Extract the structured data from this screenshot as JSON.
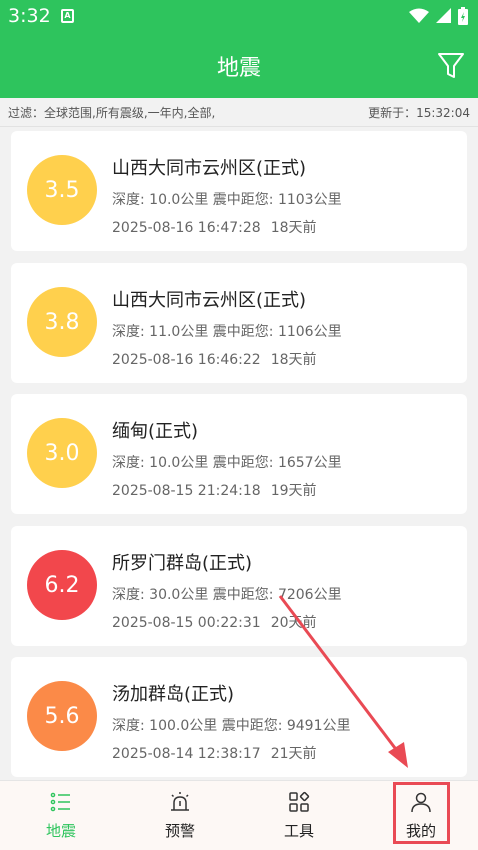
{
  "status": {
    "time": "3:32",
    "app_icon": "A"
  },
  "appbar": {
    "title": "地震"
  },
  "filter": {
    "text": "过滤：全球范围,所有震级,一年内,全部,",
    "updated": "更新于：15:32:04"
  },
  "quakes": [
    {
      "mag": "3.5",
      "place": "山西大同市云州区(正式)",
      "detail": "深度: 10.0公里   震中距您: 1103公里",
      "time": "2025-08-16 16:47:28",
      "ago": "18天前",
      "color": "#ffd04d"
    },
    {
      "mag": "3.8",
      "place": "山西大同市云州区(正式)",
      "detail": "深度: 11.0公里   震中距您: 1106公里",
      "time": "2025-08-16 16:46:22",
      "ago": "18天前",
      "color": "#ffd04d"
    },
    {
      "mag": "3.0",
      "place": "缅甸(正式)",
      "detail": "深度: 10.0公里   震中距您: 1657公里",
      "time": "2025-08-15 21:24:18",
      "ago": "19天前",
      "color": "#ffd04d"
    },
    {
      "mag": "6.2",
      "place": "所罗门群岛(正式)",
      "detail": "深度: 30.0公里   震中距您: 7206公里",
      "time": "2025-08-15 00:22:31",
      "ago": "20天前",
      "color": "#f2474c"
    },
    {
      "mag": "5.6",
      "place": "汤加群岛(正式)",
      "detail": "深度: 100.0公里   震中距您: 9491公里",
      "time": "2025-08-14 12:38:17",
      "ago": "21天前",
      "color": "#fb8a48"
    }
  ],
  "nav": [
    {
      "label": "地震",
      "icon": "list-icon",
      "active": true
    },
    {
      "label": "预警",
      "icon": "alarm-icon",
      "active": false
    },
    {
      "label": "工具",
      "icon": "grid-icon",
      "active": false
    },
    {
      "label": "我的",
      "icon": "person-icon",
      "active": false
    }
  ],
  "colors": {
    "brand": "#2ec45d",
    "highlight": "#e94a54"
  }
}
